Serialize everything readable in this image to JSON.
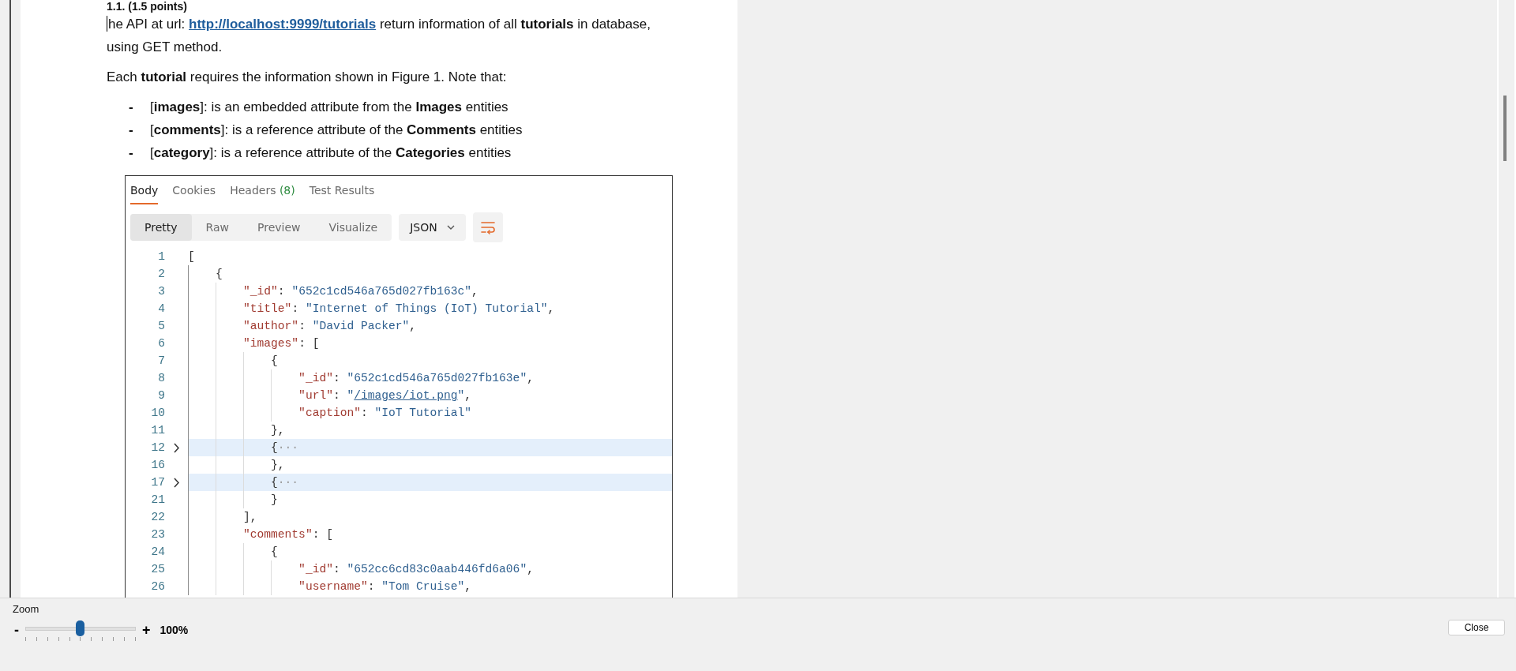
{
  "document": {
    "heading": "1.1. (1.5 points)",
    "intro": {
      "before": "he API at url: ",
      "link": "http://localhost:9999/tutorials",
      "after": " return information of all **tutorials** in database, using GET method."
    },
    "paragraph": "Each **tutorial** requires the information shown in Figure 1. Note that:",
    "bullets": [
      {
        "marker": "-",
        "text": "[**images**]: is an embedded attribute from the **Images** entities"
      },
      {
        "marker": "-",
        "text": "[**comments**]: is a reference attribute of the **Comments** entities"
      },
      {
        "marker": "-",
        "text": "[**category**]: is a reference attribute of the **Categories** entities"
      }
    ]
  },
  "response_panel": {
    "tabs": [
      {
        "label": "Body",
        "selected": true
      },
      {
        "label": "Cookies",
        "selected": false
      },
      {
        "label": "Headers",
        "count": "(8)",
        "selected": false
      },
      {
        "label": "Test Results",
        "selected": false
      }
    ],
    "view_modes": [
      {
        "label": "Pretty",
        "selected": true
      },
      {
        "label": "Raw",
        "selected": false
      },
      {
        "label": "Preview",
        "selected": false
      },
      {
        "label": "Visualize",
        "selected": false
      }
    ],
    "format": "JSON",
    "lines": [
      {
        "number": "1",
        "folded": false,
        "tokens": [
          {
            "kind": "p",
            "text": "["
          }
        ]
      },
      {
        "number": "2",
        "folded": false,
        "tokens": [
          {
            "kind": "p",
            "text": "    {"
          }
        ]
      },
      {
        "number": "3",
        "folded": false,
        "tokens": [
          {
            "kind": "k",
            "text": "        \"_id\""
          },
          {
            "kind": "p",
            "text": ": "
          },
          {
            "kind": "s",
            "text": "\"652c1cd546a765d027fb163c\""
          },
          {
            "kind": "p",
            "text": ","
          }
        ]
      },
      {
        "number": "4",
        "folded": false,
        "tokens": [
          {
            "kind": "k",
            "text": "        \"title\""
          },
          {
            "kind": "p",
            "text": ": "
          },
          {
            "kind": "s",
            "text": "\"Internet of Things (IoT) Tutorial\""
          },
          {
            "kind": "p",
            "text": ","
          }
        ]
      },
      {
        "number": "5",
        "folded": false,
        "tokens": [
          {
            "kind": "k",
            "text": "        \"author\""
          },
          {
            "kind": "p",
            "text": ": "
          },
          {
            "kind": "s",
            "text": "\"David Packer\""
          },
          {
            "kind": "p",
            "text": ","
          }
        ]
      },
      {
        "number": "6",
        "folded": false,
        "tokens": [
          {
            "kind": "k",
            "text": "        \"images\""
          },
          {
            "kind": "p",
            "text": ": ["
          }
        ]
      },
      {
        "number": "7",
        "folded": false,
        "tokens": [
          {
            "kind": "p",
            "text": "            {"
          }
        ]
      },
      {
        "number": "8",
        "folded": false,
        "tokens": [
          {
            "kind": "k",
            "text": "                \"_id\""
          },
          {
            "kind": "p",
            "text": ": "
          },
          {
            "kind": "s",
            "text": "\"652c1cd546a765d027fb163e\""
          },
          {
            "kind": "p",
            "text": ","
          }
        ]
      },
      {
        "number": "9",
        "folded": false,
        "tokens": [
          {
            "kind": "k",
            "text": "                \"url\""
          },
          {
            "kind": "p",
            "text": ": "
          },
          {
            "kind": "s",
            "text": "\""
          },
          {
            "kind": "l",
            "text": "/images/iot.png"
          },
          {
            "kind": "s",
            "text": "\""
          },
          {
            "kind": "p",
            "text": ","
          }
        ]
      },
      {
        "number": "10",
        "folded": false,
        "tokens": [
          {
            "kind": "k",
            "text": "                \"caption\""
          },
          {
            "kind": "p",
            "text": ": "
          },
          {
            "kind": "s",
            "text": "\"IoT Tutorial\""
          }
        ]
      },
      {
        "number": "11",
        "folded": false,
        "tokens": [
          {
            "kind": "p",
            "text": "            },"
          }
        ]
      },
      {
        "number": "12",
        "folded": true,
        "tokens": [
          {
            "kind": "p",
            "text": "            {"
          },
          {
            "kind": "e",
            "text": "···"
          }
        ]
      },
      {
        "number": "16",
        "folded": false,
        "tokens": [
          {
            "kind": "p",
            "text": "            },"
          }
        ]
      },
      {
        "number": "17",
        "folded": true,
        "tokens": [
          {
            "kind": "p",
            "text": "            {"
          },
          {
            "kind": "e",
            "text": "···"
          }
        ]
      },
      {
        "number": "21",
        "folded": false,
        "tokens": [
          {
            "kind": "p",
            "text": "            }"
          }
        ]
      },
      {
        "number": "22",
        "folded": false,
        "tokens": [
          {
            "kind": "p",
            "text": "        ],"
          }
        ]
      },
      {
        "number": "23",
        "folded": false,
        "tokens": [
          {
            "kind": "k",
            "text": "        \"comments\""
          },
          {
            "kind": "p",
            "text": ": ["
          }
        ]
      },
      {
        "number": "24",
        "folded": false,
        "tokens": [
          {
            "kind": "p",
            "text": "            {"
          }
        ]
      },
      {
        "number": "25",
        "folded": false,
        "tokens": [
          {
            "kind": "k",
            "text": "                \"_id\""
          },
          {
            "kind": "p",
            "text": ": "
          },
          {
            "kind": "s",
            "text": "\"652cc6cd83c0aab446fd6a06\""
          },
          {
            "kind": "p",
            "text": ","
          }
        ]
      },
      {
        "number": "26",
        "folded": false,
        "tokens": [
          {
            "kind": "k",
            "text": "                \"username\""
          },
          {
            "kind": "p",
            "text": ": "
          },
          {
            "kind": "s",
            "text": "\"Tom Cruise\""
          },
          {
            "kind": "p",
            "text": ","
          }
        ]
      }
    ]
  },
  "zoom_bar": {
    "label": "Zoom",
    "minus": "-",
    "plus": "+",
    "level": 0.5,
    "reading": "100%"
  },
  "close_button": "Close"
}
